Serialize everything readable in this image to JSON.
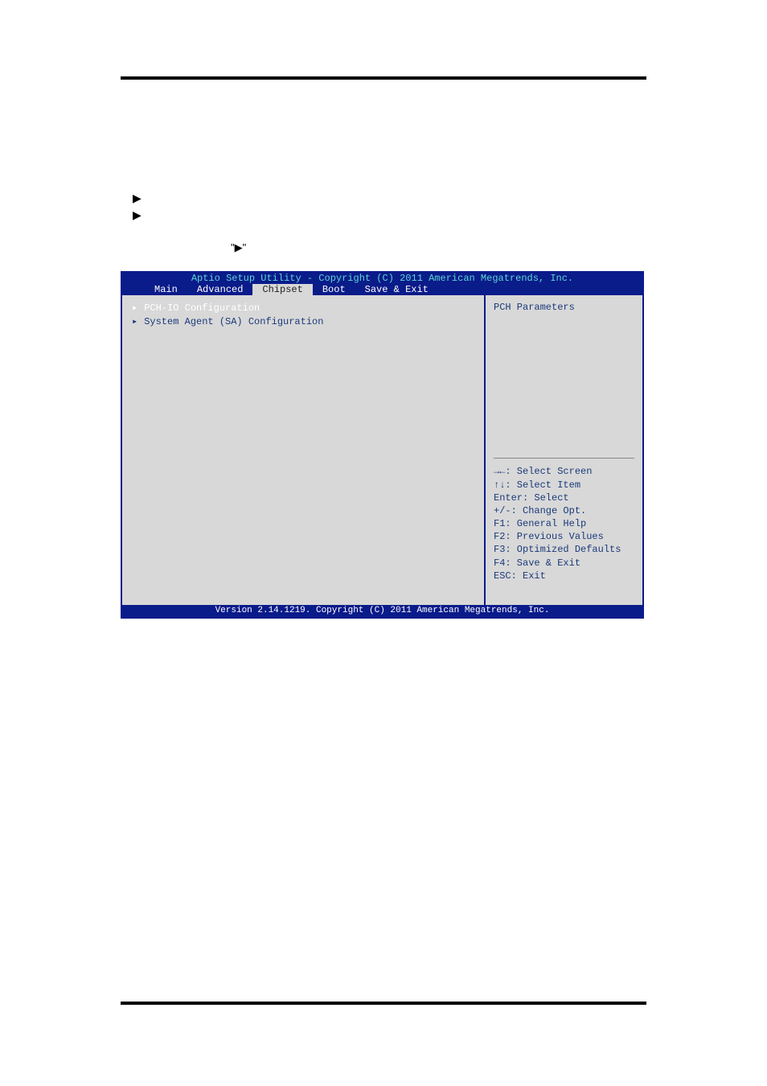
{
  "arrows": {
    "glyph": "▶",
    "quoted": "\"▶\""
  },
  "bios": {
    "title": "Aptio Setup Utility - Copyright (C) 2011 American Megatrends, Inc.",
    "tabs": {
      "main": "Main",
      "advanced": "Advanced",
      "chipset": "Chipset",
      "boot": "Boot",
      "save": "Save & Exit"
    },
    "menu": {
      "item1": "PCH-IO Configuration",
      "item2": "System Agent (SA) Configuration"
    },
    "help": "PCH Parameters",
    "keys": {
      "k1": "→←: Select Screen",
      "k2": "↑↓: Select Item",
      "k3": "Enter: Select",
      "k4": "+/-: Change Opt.",
      "k5": "F1: General Help",
      "k6": "F2: Previous Values",
      "k7": "F3: Optimized Defaults",
      "k8": "F4: Save & Exit",
      "k9": "ESC: Exit"
    },
    "footer": "Version 2.14.1219. Copyright (C) 2011 American Megatrends, Inc."
  }
}
